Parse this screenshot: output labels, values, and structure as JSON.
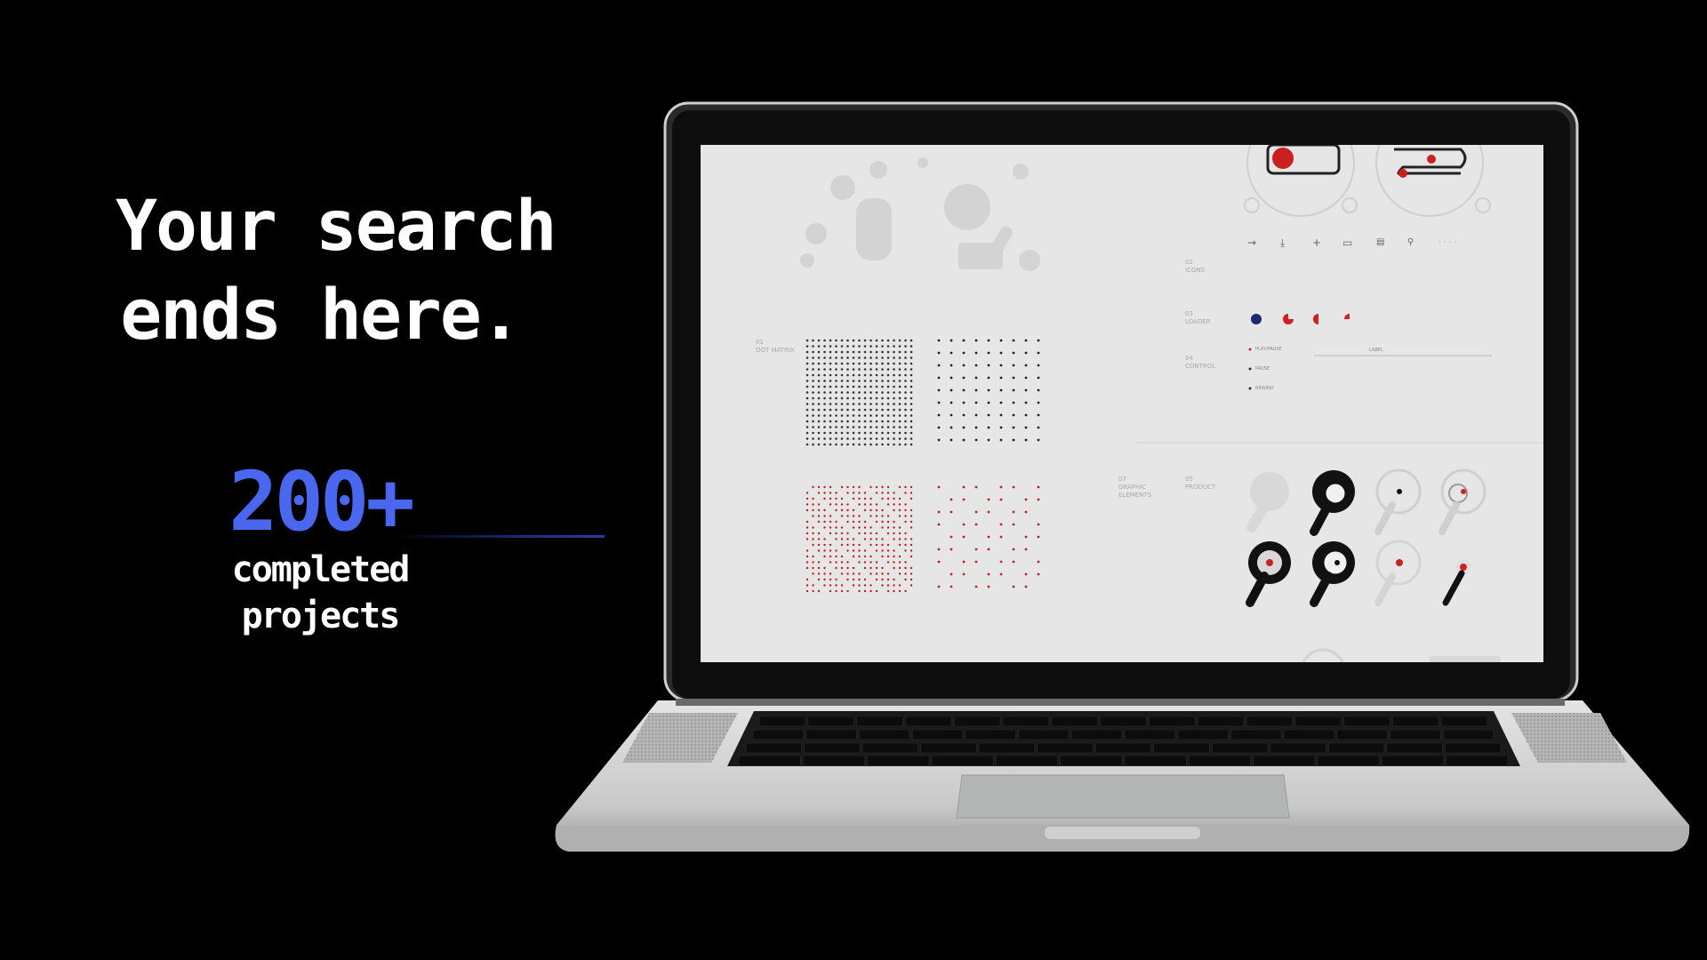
{
  "hero": {
    "headline_line1": "Your search",
    "headline_line2": "ends here.",
    "stat_number": "200+",
    "stat_label_line1": "completed",
    "stat_label_line2": "projects"
  },
  "colors": {
    "background": "#000000",
    "accent_blue": "#4a67f0",
    "screen_bg": "#e6e6e6",
    "screen_red": "#cc2222"
  },
  "screen": {
    "sections": {
      "dot_matrix": "01\nDOT MATRIX",
      "icons": "02\nICONS",
      "loader": "03\nLOADER",
      "control": "04\nCONTROL",
      "graphic_elements": "07\nGRAPHIC\nELEMENTS",
      "product": "05\nPRODUCT"
    },
    "controls": [
      "PLAY/PAUSE",
      "PAUSE",
      "REWIND"
    ],
    "slider_label": "LABEL",
    "icons": [
      "arrow-right-icon",
      "download-icon",
      "plus-icon",
      "toggle-icon",
      "keyboard-icon",
      "search-icon"
    ]
  }
}
